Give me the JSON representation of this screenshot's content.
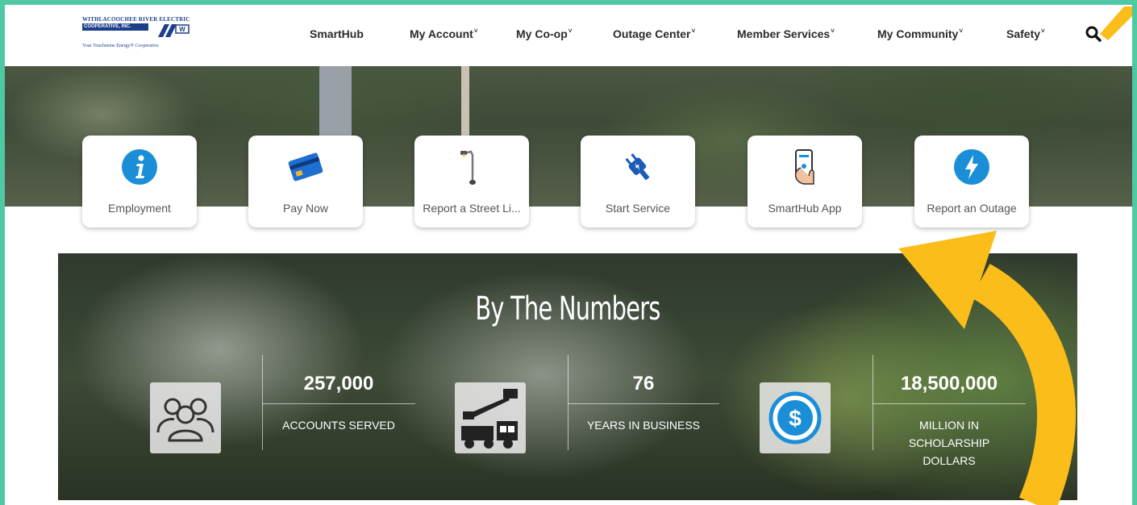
{
  "logo": {
    "line1": "WITHLACOOCHEE RIVER ELECTRIC",
    "line2": "COOPERATIVE, INC.",
    "tagline": "Your Touchstone Energy® Cooperative"
  },
  "nav": {
    "items": [
      {
        "label": "SmartHub",
        "chevron": ""
      },
      {
        "label": "My Account",
        "chevron": "˅"
      },
      {
        "label": "My Co-op",
        "chevron": "˅"
      },
      {
        "label": "Outage Center",
        "chevron": "˅"
      },
      {
        "label": "Member Services",
        "chevron": "˅"
      },
      {
        "label": "My Community",
        "chevron": "˅"
      },
      {
        "label": "Safety",
        "chevron": "˅"
      }
    ]
  },
  "quick_links": [
    {
      "label": "Employment",
      "icon": "info-icon"
    },
    {
      "label": "Pay Now",
      "icon": "credit-card-icon"
    },
    {
      "label": "Report a Street Li...",
      "icon": "street-light-icon"
    },
    {
      "label": "Start Service",
      "icon": "plug-icon"
    },
    {
      "label": "SmartHub App",
      "icon": "phone-app-icon"
    },
    {
      "label": "Report an Outage",
      "icon": "lightning-icon"
    }
  ],
  "numbers": {
    "title": "By The Numbers",
    "stats": [
      {
        "value": "257,000",
        "label": "ACCOUNTS SERVED",
        "icon": "people-icon"
      },
      {
        "value": "76",
        "label": "YEARS IN BUSINESS",
        "icon": "bucket-truck-icon"
      },
      {
        "value": "18,500,000",
        "label": "MILLION IN SCHOLARSHIP DOLLARS",
        "icon": "dollar-coin-icon"
      }
    ]
  },
  "colors": {
    "frame": "#4ec9a4",
    "brand_blue": "#1d3f8a",
    "icon_blue": "#1a8fd8",
    "arrow": "#fbbd1a"
  }
}
